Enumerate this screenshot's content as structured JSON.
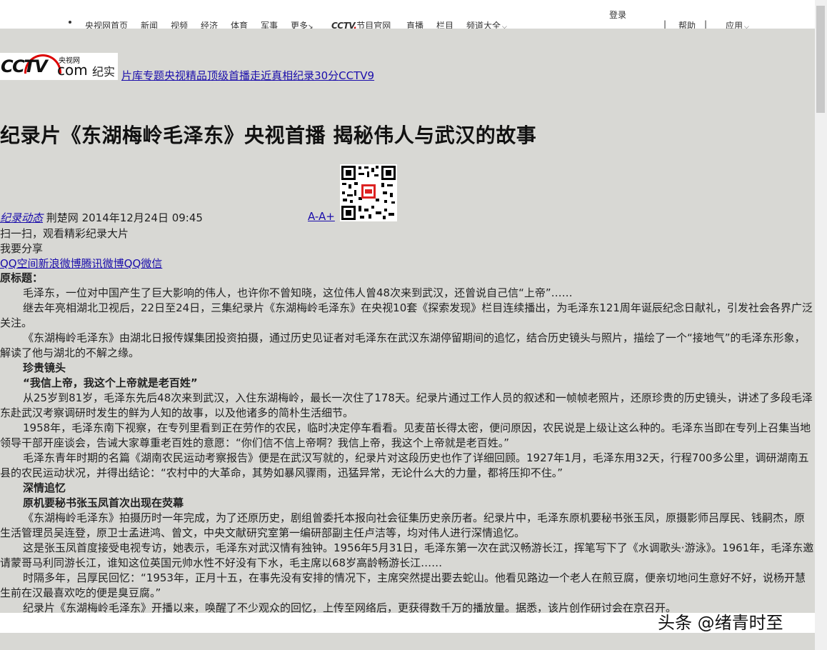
{
  "topnav": {
    "items": [
      "央视网首页",
      "新闻",
      "视频",
      "经济",
      "体育",
      "军事",
      "更多",
      "节目官网",
      "直播",
      "栏目",
      "频道大全"
    ],
    "more_arrow": "↘",
    "chevron": "⌵",
    "cctv_brand": "CCTV",
    "cctv_dot": ".",
    "login": "登录",
    "help": "帮助",
    "apps": "应用",
    "sep": "|"
  },
  "logo": {
    "cctv": "CCTV",
    "com": "com",
    "site": "央视网",
    "channel": "纪实"
  },
  "category_links": [
    "片库",
    "专题",
    "央视精品",
    "顶级首播",
    "走近真相",
    "纪录30分",
    "CCTV9"
  ],
  "title": "纪录片《东湖梅岭毛泽东》央视首播 揭秘伟人与武汉的故事",
  "meta": {
    "category": "纪录动态",
    "source": "荆楚网",
    "datetime": "2014年12月24日 09:45",
    "font_controls": "A-A+"
  },
  "qr_caption": "扫一扫，观看精彩纪录大片",
  "share": {
    "label": "我要分享",
    "links": [
      "QQ空间",
      "新浪微博",
      "腾讯微博",
      "QQ",
      "微信"
    ]
  },
  "article": {
    "orig_title_label": "原标题：",
    "paragraphs": [
      "毛泽东，一位对中国产生了巨大影响的伟人，也许你不曾知晓，这位伟人曾48次来到武汉，还曾说自己信“上帝”……",
      "继去年亮相湖北卫视后，22日至24日，三集纪录片《东湖梅岭毛泽东》在央视10套《探索发现》栏目连续播出，为毛泽东121周年诞辰纪念日献礼，引发社会各界广泛关注。",
      "《东湖梅岭毛泽东》由湖北日报传媒集团投资拍摄，通过历史见证者对毛泽东在武汉东湖停留期间的追忆，结合历史镜头与照片，描绘了一个“接地气”的毛泽东形象，解读了他与湖北的不解之缘。"
    ],
    "section1": "珍贵镜头",
    "section1_sub": "“我信上帝，我这个上帝就是老百姓”",
    "paragraphs2": [
      "从25岁到81岁，毛泽东先后48次来到武汉，入住东湖梅岭，最长一次住了178天。纪录片通过工作人员的叙述和一帧帧老照片，还原珍贵的历史镜头，讲述了多段毛泽东赴武汉考察调研时发生的鲜为人知的故事，以及他诸多的简朴生活细节。",
      "1958年，毛泽东南下视察，在专列里看到正在劳作的农民，临时决定停车看看。见麦苗长得太密，便问原因，农民说是上级让这么种的。毛泽东当即在专列上召集当地领导干部开座谈会，告诫大家尊重老百姓的意愿：“你们信不信上帝啊？我信上帝，我这个上帝就是老百姓。”",
      "毛泽东青年时期的名篇《湖南农民运动考察报告》便是在武汉写就的，纪录片对这段历史也作了详细回顾。1927年1月，毛泽东用32天，行程700多公里，调研湖南五县的农民运动状况，并得出结论：“农村中的大革命，其势如暴风骤雨，迅猛异常，无论什么大的力量，都将压抑不住。”"
    ],
    "section2": "深情追忆",
    "section2_sub": "原机要秘书张玉凤首次出现在荧幕",
    "paragraphs3": [
      "《东湖梅岭毛泽东》拍摄历时一年完成，为了还原历史，剧组曾委托本报向社会征集历史亲历者。纪录片中，毛泽东原机要秘书张玉凤，原摄影师吕厚民、钱嗣杰，原生活管理员吴连登，原卫士孟进鸿、曾文，中央文献研究室第一编研部副主任卢洁等，均对伟人进行深情追忆。",
      "这是张玉凤首度接受电视专访，她表示，毛泽东对武汉情有独钟。1956年5月31日，毛泽东第一次在武汉畅游长江，挥笔写下了《水调歌头·游泳》。1961年，毛泽东邀请蒙哥马利同游长江，谁知这位英国元帅水性不好没有下水，毛主席以68岁高龄畅游长江……",
      "时隔多年，吕厚民回忆：“1953年，正月十五，在事先没有安排的情况下，主席突然提出要去蛇山。他看见路边一个老人在煎豆腐，便亲切地问生意好不好，说杨开慧生前在汉最喜欢吃的便是臭豆腐。”",
      "纪录片《东湖梅岭毛泽东》开播以来，唤醒了不少观众的回忆，上传至网络后，更获得数千万的播放量。据悉，该片创作研讨会在京召开。"
    ]
  },
  "watermark": "头条 @绪青时至"
}
